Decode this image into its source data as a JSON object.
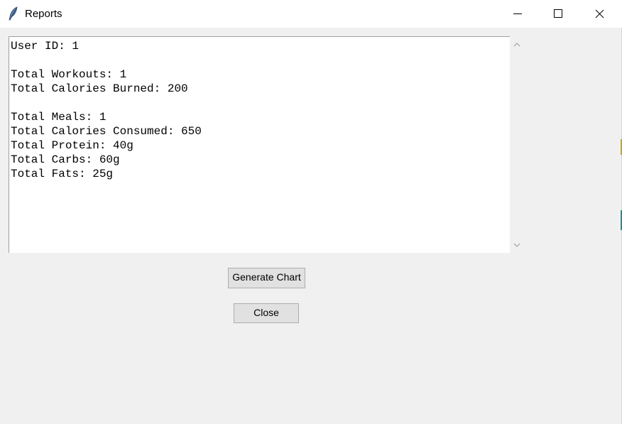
{
  "window": {
    "title": "Reports",
    "icon": "feather-icon",
    "controls": {
      "minimize_icon": "minimize-icon",
      "maximize_icon": "maximize-icon",
      "close_icon": "close-icon"
    }
  },
  "report": {
    "lines": [
      "User ID: 1",
      "",
      "Total Workouts: 1",
      "Total Calories Burned: 200",
      "",
      "Total Meals: 1",
      "Total Calories Consumed: 650",
      "Total Protein: 40g",
      "Total Carbs: 60g",
      "Total Fats: 25g"
    ]
  },
  "scrollbar": {
    "up_icon": "chevron-up-icon",
    "down_icon": "chevron-down-icon"
  },
  "buttons": {
    "generate_chart": "Generate Chart",
    "close": "Close"
  },
  "colors": {
    "window_bg": "#f0f0f0",
    "titlebar_bg": "#ffffff",
    "text_bg": "#ffffff",
    "button_bg": "#e1e1e1",
    "button_border": "#adadad"
  }
}
